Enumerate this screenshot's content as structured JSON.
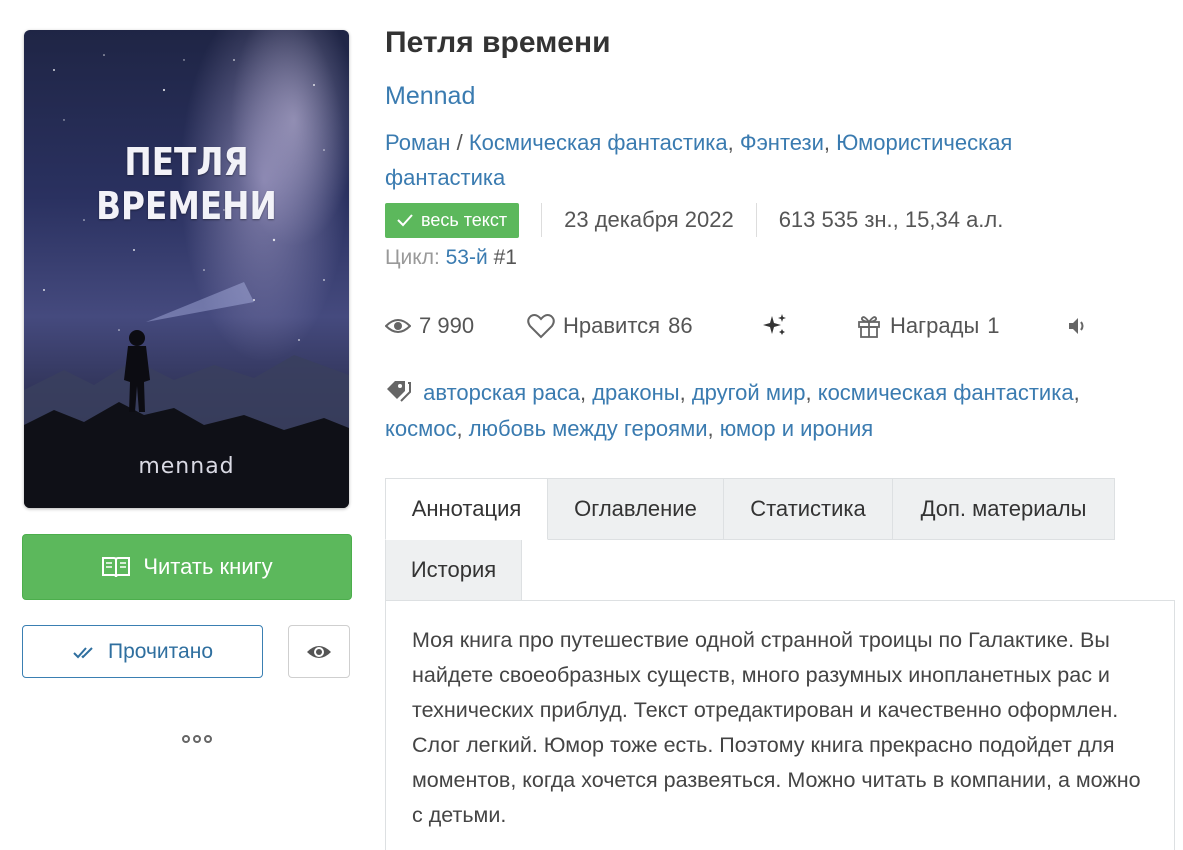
{
  "cover": {
    "title": "ПЕТЛЯ ВРЕМЕНИ",
    "author": "mennad"
  },
  "book": {
    "title": "Петля времени",
    "author": "Mennad",
    "form": "Роман",
    "genre_sep": "/",
    "genres": [
      "Космическая фантастика",
      "Фэнтези",
      "Юмористическая фантастика"
    ],
    "status_badge": "весь текст",
    "date": "23 декабря 2022",
    "size": "613 535 зн., 15,34 а.л.",
    "cycle_label": "Цикл:",
    "cycle_name": "53-й",
    "cycle_num": "#1"
  },
  "stats": {
    "views": "7 990",
    "likes_label": "Нравится",
    "likes": "86",
    "awards_label": "Награды",
    "awards": "1"
  },
  "tags": [
    "авторская раса",
    "драконы",
    "другой мир",
    "космическая фантастика",
    "космос",
    "любовь между героями",
    "юмор и ирония"
  ],
  "actions": {
    "read": "Читать книгу",
    "done": "Прочитано"
  },
  "tabs": [
    "Аннотация",
    "Оглавление",
    "Статистика",
    "Доп. материалы",
    "История"
  ],
  "annotation": "Моя книга про путешествие одной странной троицы по Галактике. Вы найдете своеобразных существ, много разумных инопланетных рас и технических приблуд. Текст отредактирован и качественно оформлен. Слог легкий. Юмор тоже есть. Поэтому книга прекрасно подойдет для моментов, когда хочется развеяться. Можно читать в компании, а можно с детьми.",
  "colors": {
    "green": "#5cb85c",
    "link": "#3a7bb0",
    "tab_bg": "#eef0f1"
  }
}
